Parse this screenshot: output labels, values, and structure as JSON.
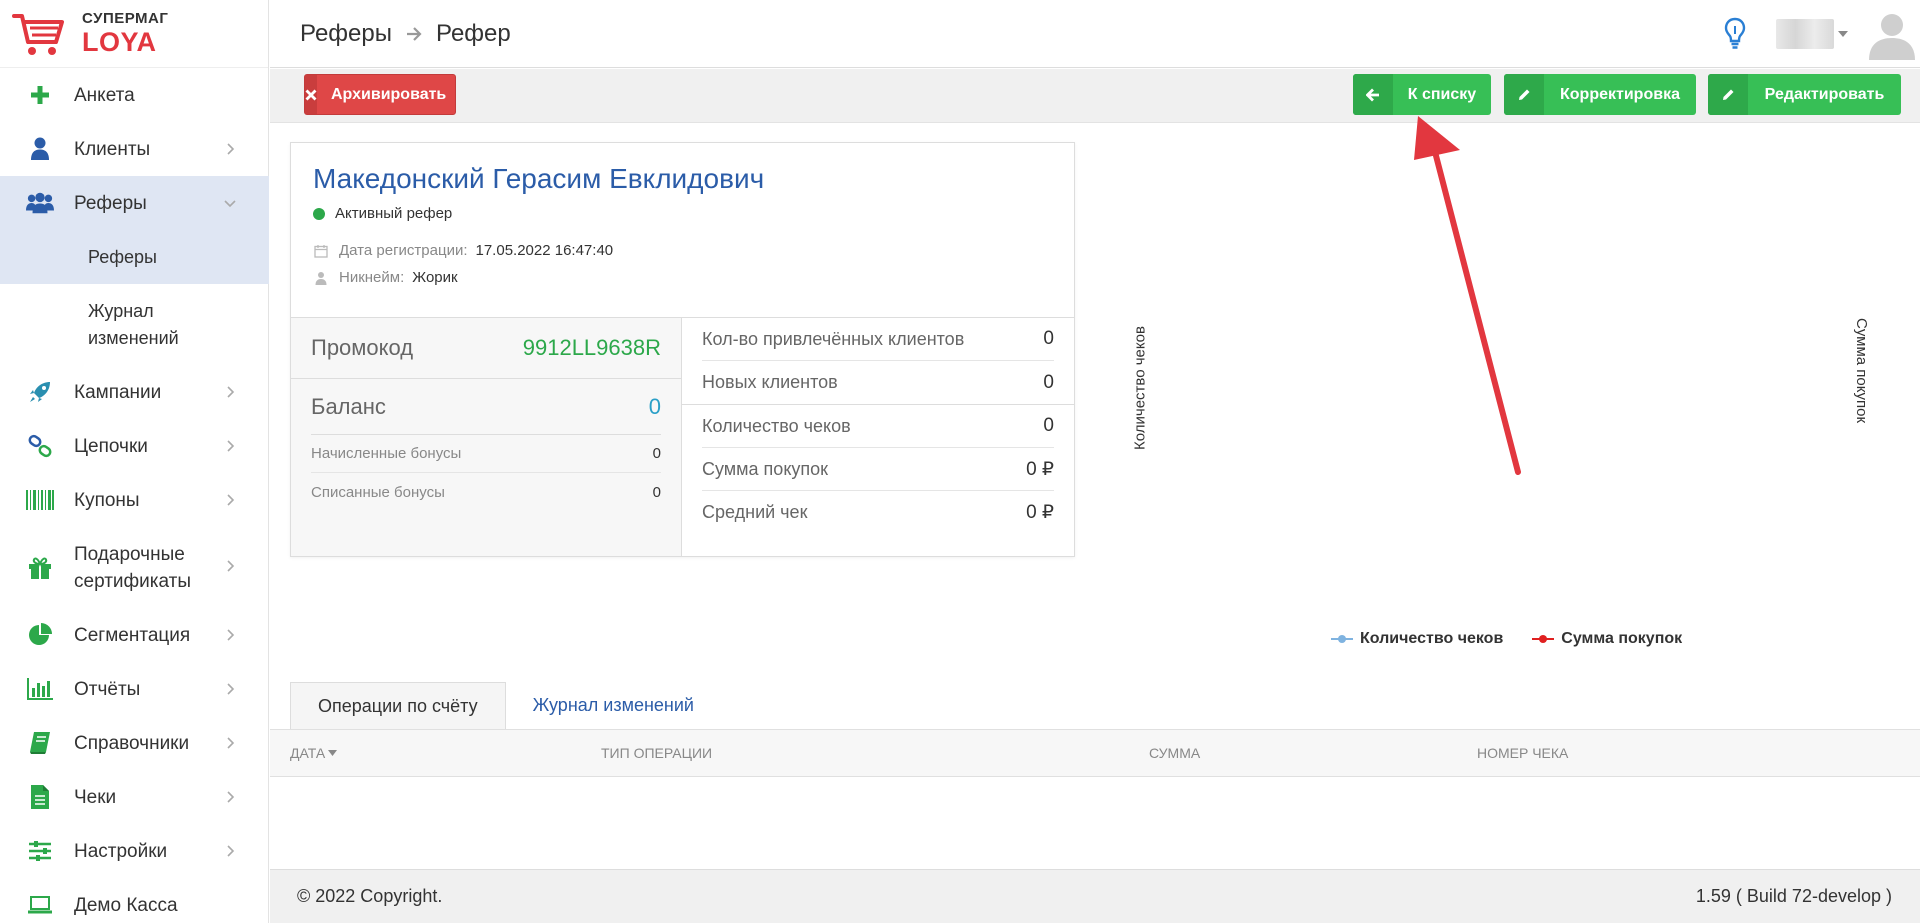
{
  "brand": {
    "line1": "СУПЕРМАГ",
    "line2": "LOYA"
  },
  "sidebar": {
    "items": [
      {
        "label": "Анкета",
        "icon": "plus-icon",
        "color": "#2ca84a"
      },
      {
        "label": "Клиенты",
        "icon": "user-icon",
        "color": "#2b5ca8"
      },
      {
        "label": "Реферы",
        "icon": "users-icon",
        "color": "#2b5ca8"
      },
      {
        "label": "Кампании",
        "icon": "rocket-icon",
        "color": "#2a8fb0"
      },
      {
        "label": "Цепочки",
        "icon": "link-icon",
        "color": "#2ca84a"
      },
      {
        "label": "Купоны",
        "icon": "barcode-icon",
        "color": "#2ca84a"
      },
      {
        "label": "Подарочные сертификаты",
        "icon": "gift-icon",
        "color": "#2ca84a"
      },
      {
        "label": "Сегментация",
        "icon": "pie-chart-icon",
        "color": "#2ca84a"
      },
      {
        "label": "Отчёты",
        "icon": "bar-chart-icon",
        "color": "#2ca84a"
      },
      {
        "label": "Справочники",
        "icon": "book-icon",
        "color": "#2ca84a"
      },
      {
        "label": "Чеки",
        "icon": "file-icon",
        "color": "#2ca84a"
      },
      {
        "label": "Настройки",
        "icon": "sliders-icon",
        "color": "#2ca84a"
      },
      {
        "label": "Демо Касса",
        "icon": "laptop-icon",
        "color": "#2ca84a"
      }
    ],
    "subitems": [
      {
        "label": "Реферы"
      },
      {
        "label": "Журнал изменений"
      }
    ]
  },
  "header": {
    "crumb1": "Реферы",
    "crumb2": "Рефер"
  },
  "toolbar": {
    "archive_label": "Архивировать",
    "to_list_label": "К списку",
    "correct_label": "Корректировка",
    "edit_label": "Редактировать"
  },
  "referrer": {
    "name": "Македонский Герасим Евклидович",
    "status": "Активный рефер",
    "reg_label": "Дата регистрации:",
    "reg_value": "17.05.2022 16:47:40",
    "nick_label": "Никнейм:",
    "nick_value": "Жорик",
    "promo_label": "Промокод",
    "promo_value": "9912LL9638R",
    "balance_label": "Баланс",
    "balance_value": "0",
    "accrued_label": "Начисленные бонусы",
    "accrued_value": "0",
    "spent_label": "Списанные бонусы",
    "spent_value": "0",
    "attracted_label": "Кол-во привлечённых клиентов",
    "attracted_value": "0",
    "new_label": "Новых клиентов",
    "new_value": "0",
    "checks_label": "Количество чеков",
    "checks_value": "0",
    "sum_label": "Сумма покупок",
    "sum_value": "0 ₽",
    "avg_label": "Средний чек",
    "avg_value": "0 ₽"
  },
  "chart_data": {
    "type": "line",
    "title": "",
    "x": [],
    "series": [
      {
        "name": "Количество чеков",
        "values": [],
        "color": "#7fb3e0"
      },
      {
        "name": "Сумма покупок",
        "values": [],
        "color": "#e02020"
      }
    ],
    "ylabel_left": "Количество чеков",
    "ylabel_right": "Сумма покупок",
    "legend_position": "bottom"
  },
  "tabs": [
    {
      "label": "Операции по счёту"
    },
    {
      "label": "Журнал изменений"
    }
  ],
  "table": {
    "columns": [
      "Дата",
      "Тип операции",
      "Сумма",
      "Номер чека"
    ]
  },
  "footer": {
    "copyright": "© 2022 Copyright.",
    "version": "1.59 ( Build 72-develop )"
  },
  "colors": {
    "accent_green": "#37bf56",
    "accent_red": "#df4747",
    "link_blue": "#2b5ca8",
    "annotation_red": "#e2373f"
  }
}
